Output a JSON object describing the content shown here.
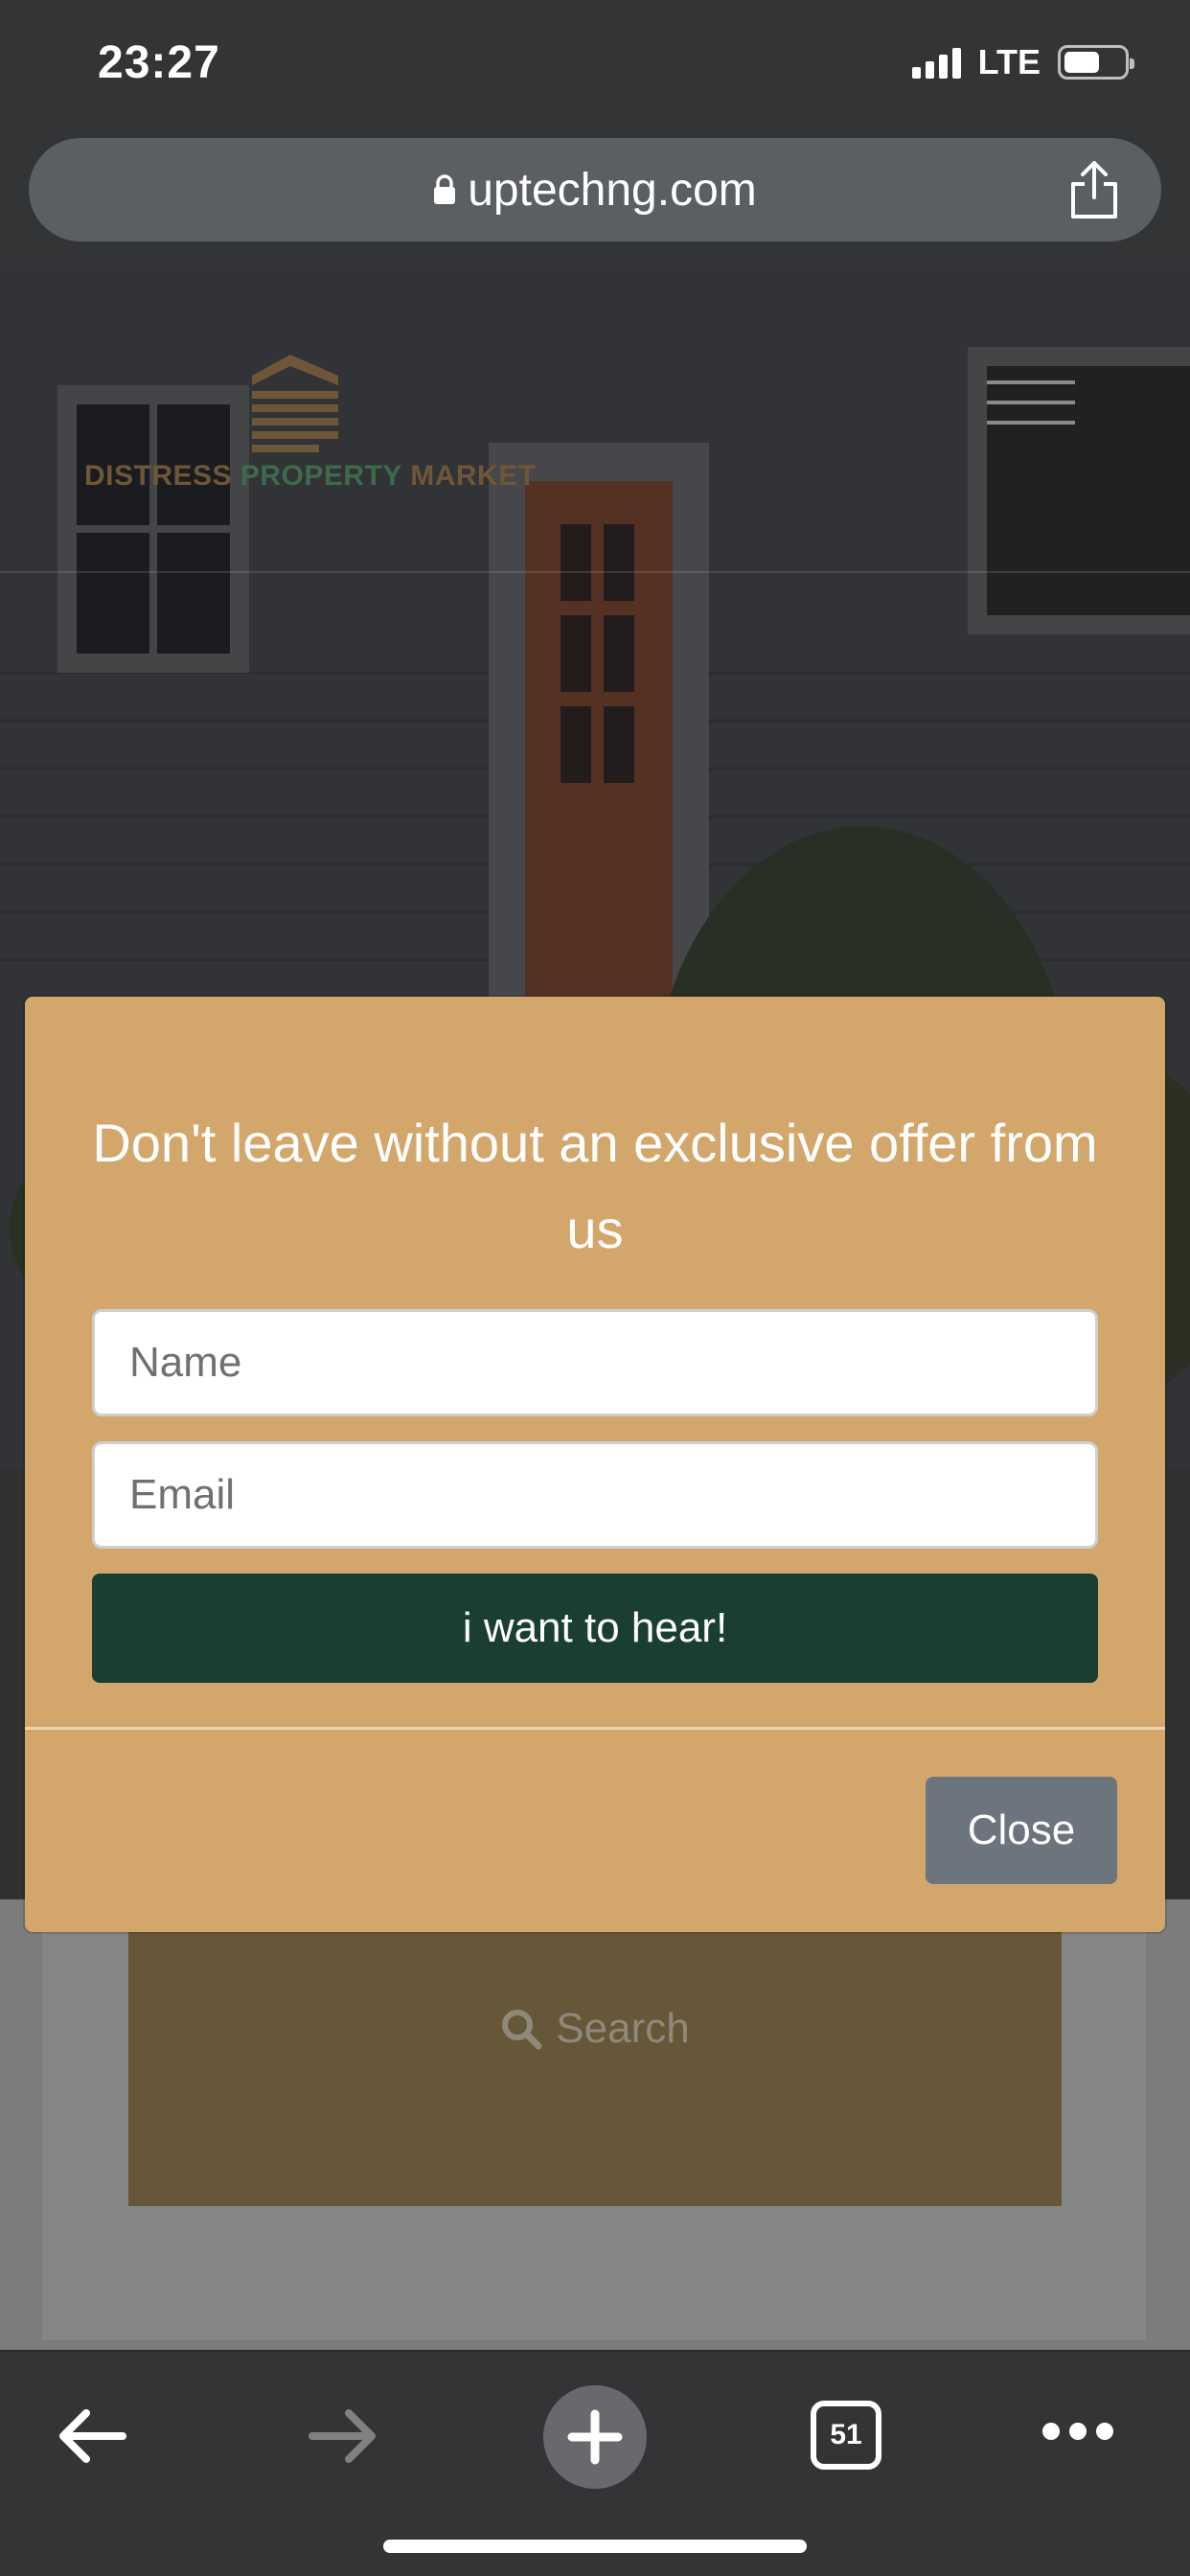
{
  "status_bar": {
    "time": "23:27",
    "network": "LTE",
    "icons": [
      "signal-icon",
      "battery-icon"
    ]
  },
  "browser": {
    "url": "uptechng.com",
    "icons": [
      "lock-icon",
      "share-icon"
    ]
  },
  "site_header": {
    "logo_words": [
      "DISTRESS",
      "PROPERTY",
      "MARKET"
    ],
    "icons": [
      "hamburger-menu-icon"
    ]
  },
  "modal": {
    "title": "Don't leave without an exclusive offer from us",
    "name_placeholder": "Name",
    "email_placeholder": "Email",
    "submit_label": "i want to hear!",
    "close_label": "Close",
    "colors": {
      "background": "#d3a66b",
      "submit": "#1a3f31",
      "close": "#6c757d"
    }
  },
  "search": {
    "label": "Search",
    "icon": "search-icon"
  },
  "toolbar": {
    "tab_count": "51",
    "icons": [
      "back-arrow-icon",
      "forward-arrow-icon",
      "plus-icon",
      "tabs-icon",
      "more-icon"
    ]
  }
}
